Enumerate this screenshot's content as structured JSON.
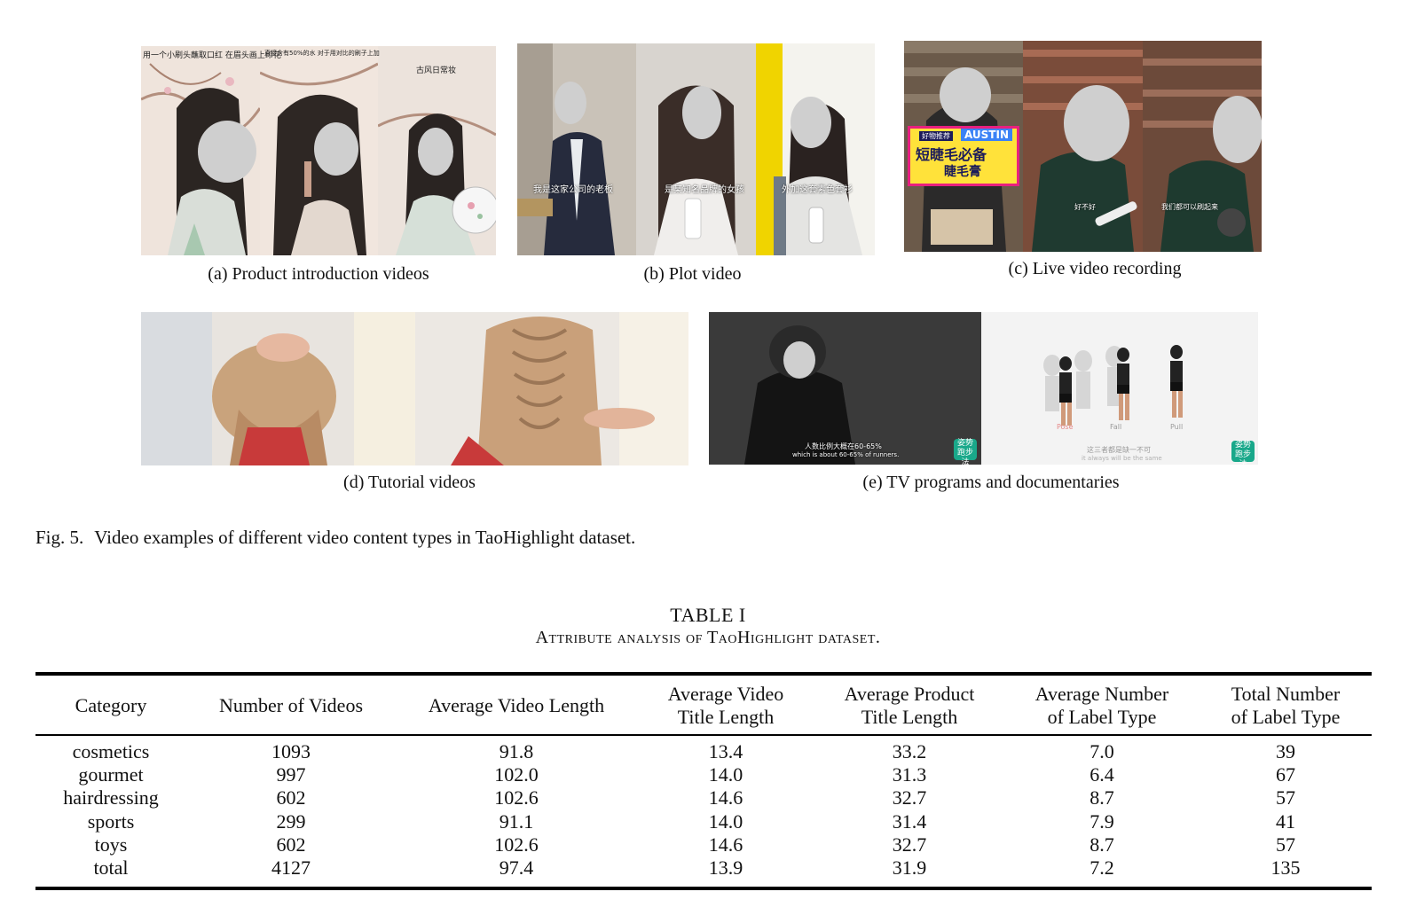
{
  "figure": {
    "panels": [
      {
        "id": "a",
        "caption": "(a) Product introduction videos"
      },
      {
        "id": "b",
        "caption": "(b) Plot video"
      },
      {
        "id": "c",
        "caption": "(c) Live video recording"
      },
      {
        "id": "d",
        "caption": "(d) Tutorial videos"
      },
      {
        "id": "e",
        "caption": "(e) TV programs and documentaries"
      }
    ],
    "overlay_text": {
      "a1": "用一个小刷头蘸取口红 在眉头画上印花",
      "a2": "直接含有50%的水 对于用对比的刷子上加",
      "a3": "古风日常妆",
      "b1": "我是这家公司的老板",
      "b2": "是某知名品牌的女孩",
      "b3": "外加这套素色套衫",
      "c_banner": "AUSTIN",
      "c_sign1": "好物推荐",
      "c_sign2": "短睫毛必备",
      "c_sign3": "睫毛膏",
      "c2": "好不好",
      "c3": "我们都可以刷起来",
      "e1_line1": "人数比例大概在60-65%",
      "e1_line2": "which is about 60-65% of runners.",
      "e2_line1": "这三者都是缺一不可",
      "e2_line2": "it always will be the same",
      "e_pose": "Pose",
      "e_fall": "Fall",
      "e_pull": "Pull",
      "badge": "姿势跑步法"
    },
    "label": "Fig. 5.",
    "caption": "Video examples of different video content types in TaoHighlight dataset."
  },
  "table": {
    "number": "TABLE I",
    "title": "Attribute analysis of TaoHighlight dataset.",
    "headers": [
      [
        "Category"
      ],
      [
        "Number of Videos"
      ],
      [
        "Average Video Length"
      ],
      [
        "Average Video",
        "Title Length"
      ],
      [
        "Average Product",
        "Title Length"
      ],
      [
        "Average Number",
        "of Label Type"
      ],
      [
        "Total Number",
        "of Label Type"
      ]
    ],
    "rows": [
      [
        "cosmetics",
        "1093",
        "91.8",
        "13.4",
        "33.2",
        "7.0",
        "39"
      ],
      [
        "gourmet",
        "997",
        "102.0",
        "14.0",
        "31.3",
        "6.4",
        "67"
      ],
      [
        "hairdressing",
        "602",
        "102.6",
        "14.6",
        "32.7",
        "8.7",
        "57"
      ],
      [
        "sports",
        "299",
        "91.1",
        "14.0",
        "31.4",
        "7.9",
        "41"
      ],
      [
        "toys",
        "602",
        "102.6",
        "14.6",
        "32.7",
        "8.7",
        "57"
      ],
      [
        "total",
        "4127",
        "97.4",
        "13.9",
        "31.9",
        "7.2",
        "135"
      ]
    ]
  }
}
